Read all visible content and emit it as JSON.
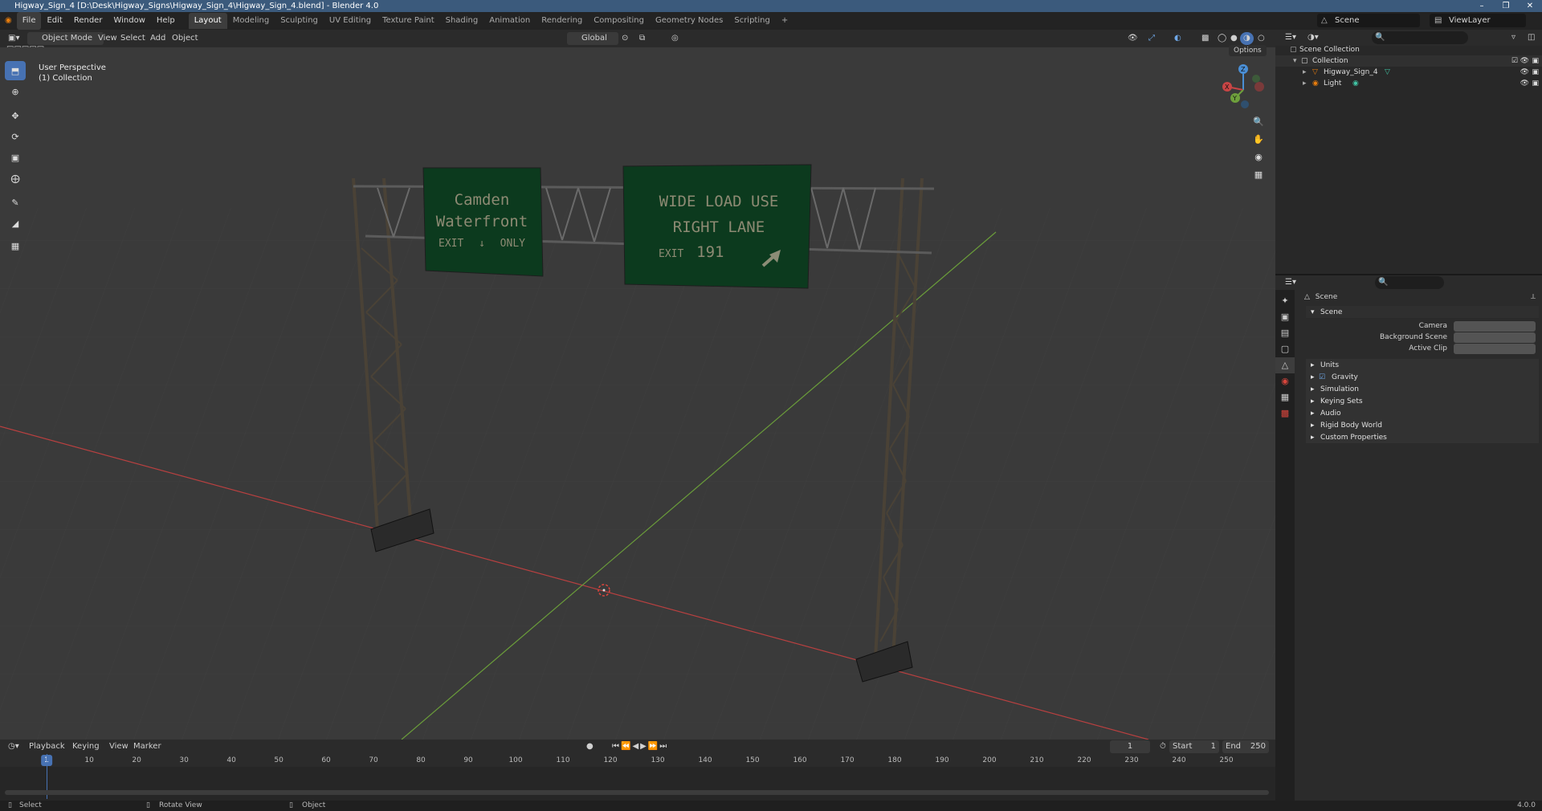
{
  "window": {
    "title": "Higway_Sign_4 [D:\\Desk\\Higway_Signs\\Higway_Sign_4\\Higway_Sign_4.blend] - Blender 4.0"
  },
  "menu": {
    "items": [
      "File",
      "Edit",
      "Render",
      "Window",
      "Help"
    ]
  },
  "workspaces": [
    "Layout",
    "Modeling",
    "Sculpting",
    "UV Editing",
    "Texture Paint",
    "Shading",
    "Animation",
    "Rendering",
    "Compositing",
    "Geometry Nodes",
    "Scripting"
  ],
  "active_workspace": "Layout",
  "scene_selector": "Scene",
  "view_layer": "ViewLayer",
  "viewport_header": {
    "mode": "Object Mode",
    "menus": [
      "View",
      "Select",
      "Add",
      "Object"
    ],
    "orientation": "Global",
    "options": "Options"
  },
  "viewport": {
    "perspective": "User Perspective",
    "collection": "(1) Collection",
    "gizmo_axes": {
      "x": "X",
      "y": "Y",
      "z": "Z"
    },
    "colors": {
      "x_axis": "#c94545",
      "y_axis": "#6ea03c",
      "z_axis": "#4a8fd6",
      "sign": "#0c3a1e"
    },
    "signs": [
      {
        "line1": "Camden",
        "line2": "Waterfront",
        "exit": "EXIT",
        "only": "ONLY"
      },
      {
        "line1": "WIDE LOAD USE",
        "line2": "RIGHT LANE",
        "exit": "EXIT",
        "number": "191"
      }
    ]
  },
  "timeline": {
    "menus": [
      "Playback",
      "Keying",
      "View",
      "Marker"
    ],
    "current_frame": "1",
    "start_label": "Start",
    "start": "1",
    "end_label": "End",
    "end": "250",
    "ticks": [
      "1",
      "10",
      "20",
      "30",
      "40",
      "50",
      "60",
      "70",
      "80",
      "90",
      "100",
      "110",
      "120",
      "130",
      "140",
      "150",
      "160",
      "170",
      "180",
      "190",
      "200",
      "210",
      "220",
      "230",
      "240",
      "250"
    ]
  },
  "outliner": {
    "root": "Scene Collection",
    "collection": "Collection",
    "objects": [
      "Higway_Sign_4",
      "Light"
    ]
  },
  "properties": {
    "context": "Scene",
    "panel_title": "Scene",
    "fields": {
      "camera": "Camera",
      "background_scene": "Background Scene",
      "active_clip": "Active Clip"
    },
    "panels": [
      "Units",
      "Gravity",
      "Simulation",
      "Keying Sets",
      "Audio",
      "Rigid Body World",
      "Custom Properties"
    ],
    "gravity_checked": true
  },
  "status": {
    "select": "Select",
    "rotate": "Rotate View",
    "object": "Object",
    "version": "4.0.0"
  }
}
